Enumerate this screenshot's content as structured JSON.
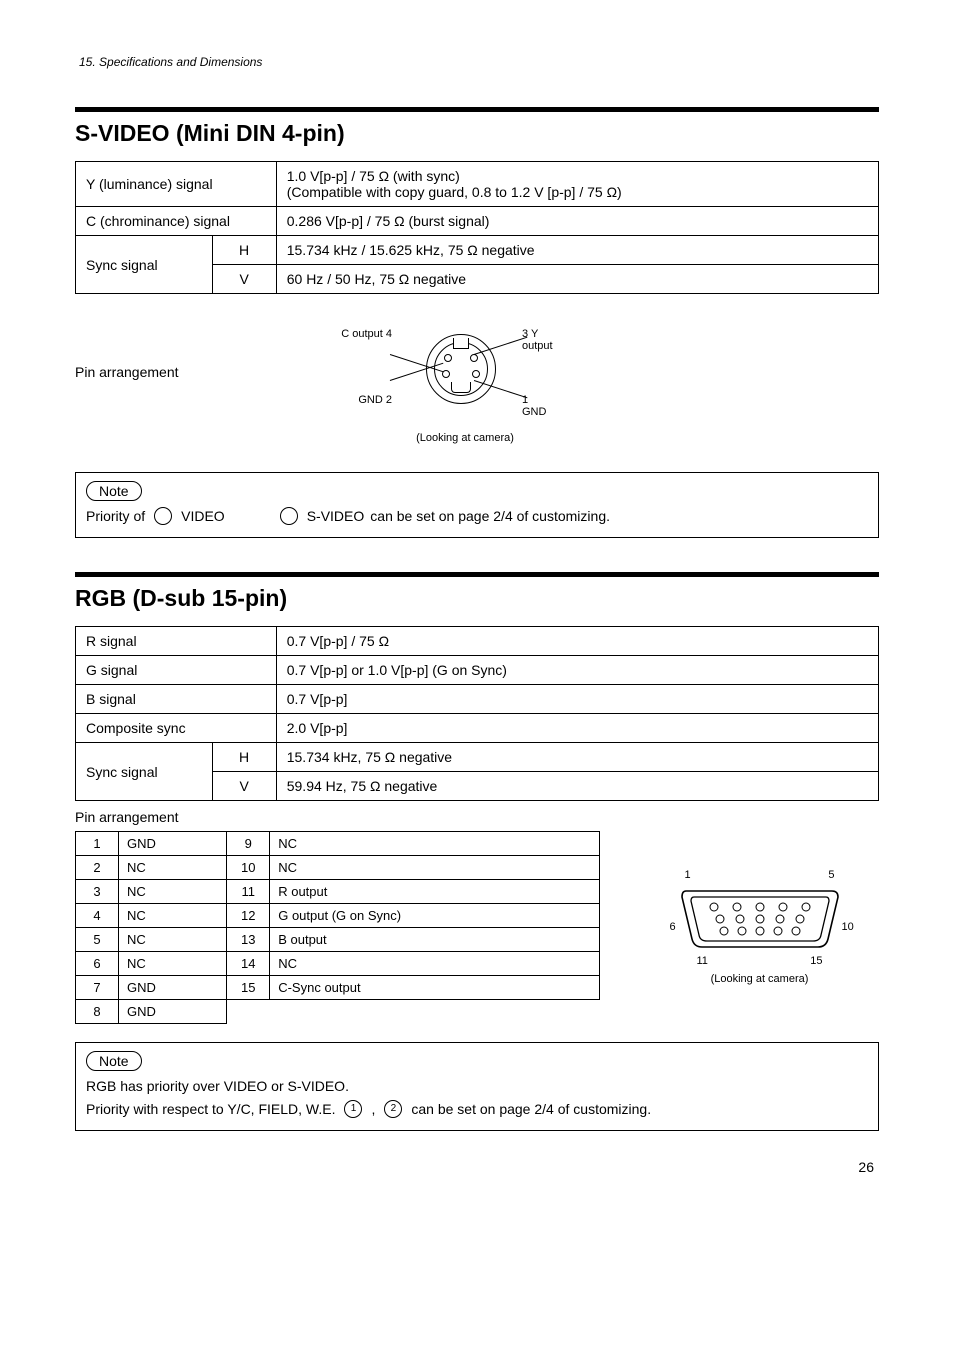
{
  "running_head": "15. Specifications and Dimensions",
  "page_number": "26",
  "svideo": {
    "title": "S-VIDEO (Mini DIN 4-pin)",
    "rows": {
      "y": {
        "label": "Y (luminance) signal",
        "value": "1.0 V[p-p] / 75 Ω (with sync)\n(Compatible with copy guard, 0.8 to 1.2 V [p-p] / 75 Ω)"
      },
      "c": {
        "label": "C (chrominance) signal",
        "value": "0.286 V[p-p] / 75 Ω  (burst signal)"
      },
      "sync": {
        "label": "Sync signal",
        "h": {
          "label": "H",
          "value": "15.734 kHz / 15.625 kHz, 75 Ω  negative"
        },
        "v": {
          "label": "V",
          "value": "60 Hz / 50 Hz, 75 Ω  negative"
        }
      }
    },
    "pin_caption": "Pin arrangement",
    "pin_labels": {
      "p1": "1  GND",
      "p2": "GND  2",
      "p3": "3   Y output",
      "p4": "C output  4"
    },
    "pin_view": "(Looking at camera)",
    "note_label": "Note",
    "note_text_before": "Priority of",
    "note_video": "VIDEO",
    "note_svideo": "S-VIDEO",
    "note_text_after": "can be set on page 2/4 of customizing."
  },
  "rgb": {
    "title": "RGB (D-sub 15-pin)",
    "rows": {
      "r": {
        "label": "R signal",
        "value": "0.7 V[p-p] / 75 Ω"
      },
      "g": {
        "label": "G signal",
        "value": "0.7 V[p-p]  or 1.0 V[p-p] (G on Sync)"
      },
      "b": {
        "label": "B signal",
        "value": "0.7 V[p-p]"
      },
      "cs": {
        "label": "Composite sync",
        "value": "2.0 V[p-p]"
      },
      "sync": {
        "label": "Sync signal",
        "h": {
          "label": "H",
          "value": "15.734 kHz, 75 Ω  negative"
        },
        "v": {
          "label": "V",
          "value": "59.94 Hz, 75 Ω  negative"
        }
      }
    },
    "pin_caption": "Pin arrangement",
    "pins": {
      "1": "GND",
      "2": "NC",
      "3": "NC",
      "4": "NC",
      "5": "NC",
      "6": "NC",
      "7": "GND",
      "8": "GND",
      "9": "NC",
      "10": "NC",
      "11": "R output",
      "12": "G output  (G on Sync)",
      "13": "B output",
      "14": "NC",
      "15": "C-Sync output"
    },
    "dsub_labels": {
      "left_top": "1",
      "right_top": "5",
      "left_mid": "6",
      "right_mid": "10",
      "left_bot": "11",
      "right_bot": "15"
    },
    "dsub_view": "(Looking at camera)",
    "note_label": "Note",
    "note_line1": "RGB has priority over VIDEO or S-VIDEO.",
    "note_line2a": "Priority with respect to Y/C, FIELD, W.E.",
    "note_circ1": "1",
    "note_circ2": "2",
    "note_line2b": "can be set on page 2/4 of customizing."
  }
}
